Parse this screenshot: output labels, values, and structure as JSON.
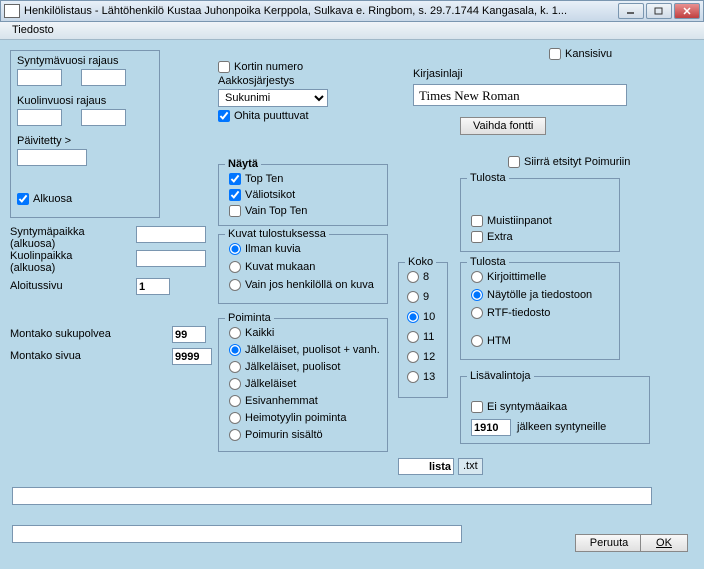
{
  "window": {
    "title": "Henkilölistaus - Lähtöhenkilö Kustaa Juhonpoika Kerppola, Sulkava e. Ringbom,  s. 29.7.1744 Kangasala, k. 1..."
  },
  "menu": {
    "tiedosto": "Tiedosto"
  },
  "groups": {
    "syntymavuosi": "Syntymävuosi rajaus",
    "kuolinvuosi": "Kuolinvuosi rajaus",
    "paivitetty": "Päivitetty  >",
    "nayta": "Näytä",
    "kuvat": "Kuvat tulostuksessa",
    "poiminta": "Poiminta",
    "koko": "Koko",
    "tulosta1": "Tulosta",
    "tulosta2": "Tulosta",
    "lisavalintoja": "Lisävalintoja"
  },
  "labels": {
    "alkuosa": "Alkuosa",
    "syntymapaikka": "Syntymäpaikka (alkuosa)",
    "kuolinpaikka": "Kuolinpaikka (alkuosa)",
    "aloitussivu": "Aloitussivu",
    "montako_sukupolvea": "Montako sukupolvea",
    "montako_sivua": "Montako sivua",
    "kortin_numero": "Kortin numero",
    "aakkosjarjestys": "Aakkosjärjestys",
    "ohita": "Ohita puuttuvat",
    "kirjasinlaji": "Kirjasinlaji",
    "vaihda_fontti": "Vaihda fontti",
    "kansisivu": "Kansisivu",
    "siirra": "Siirrä etsityt Poimuriin",
    "ei_syntymaaikaa": "Ei syntymäaikaa",
    "jalkeen": "jälkeen syntyneille",
    "lista": "lista",
    "txt": ".txt",
    "peruuta": "Peruuta",
    "ok": "OK"
  },
  "values": {
    "aloitussivu": "1",
    "sukupolvea": "99",
    "sivua": "9999",
    "font": "Times New Roman",
    "vuosi": "1910",
    "sort": "Sukunimi"
  },
  "nayta_items": {
    "topten": "Top Ten",
    "valiotsikot": "Väliotsikot",
    "vain_topten": "Vain Top Ten"
  },
  "kuvat_items": {
    "ilman": "Ilman kuvia",
    "mukaan": "Kuvat mukaan",
    "vainjos": "Vain jos henkilöllä on kuva"
  },
  "poiminta_items": {
    "kaikki": "Kaikki",
    "jalk_puolisot_vanh": "Jälkeläiset, puolisot + vanh.",
    "jalk_puolisot": "Jälkeläiset, puolisot",
    "jalkelaiset": "Jälkeläiset",
    "esivanhemmat": "Esivanhemmat",
    "heimotyylin": "Heimotyylin poiminta",
    "poimurin": "Poimurin sisältö"
  },
  "koko_items": [
    "8",
    "9",
    "10",
    "11",
    "12",
    "13"
  ],
  "tulosta1_items": {
    "muistiinpanot": "Muistiinpanot",
    "extra": "Extra"
  },
  "tulosta2_items": {
    "kirjoittimelle": "Kirjoittimelle",
    "naytolle": "Näytölle ja tiedostoon",
    "rtf": "RTF-tiedosto",
    "htm": "HTM"
  }
}
